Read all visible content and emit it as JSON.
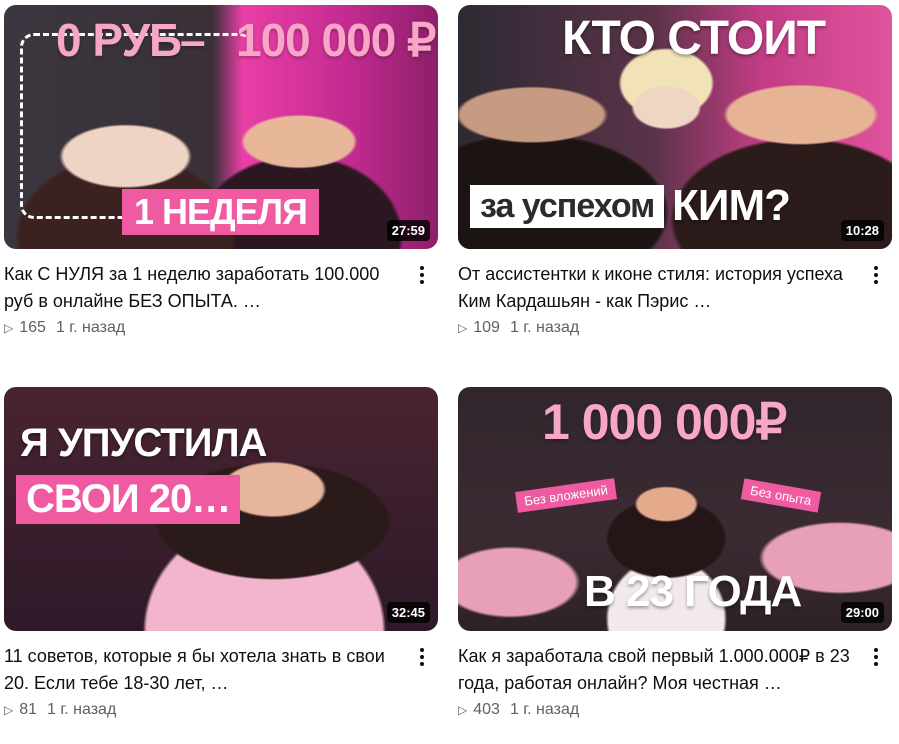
{
  "videos": [
    {
      "title": "Как С НУЛЯ за 1 неделю заработать 100.000 руб в онлайне БЕЗ ОПЫТА. …",
      "duration": "27:59",
      "views": "165",
      "age": "1 г. назад",
      "overlay": {
        "left": "0 РУБ",
        "dash": "–",
        "right": "100 000 ₽",
        "bottom": "1 НЕДЕЛЯ"
      }
    },
    {
      "title": "От ассистентки к иконе стиля: история успеха Ким Кардашьян - как Пэрис …",
      "duration": "10:28",
      "views": "109",
      "age": "1 г. назад",
      "overlay": {
        "top": "КТО СТОИТ",
        "box": "за успехом",
        "end": "КИМ?"
      }
    },
    {
      "title": "11 советов, которые я бы хотела знать в свои 20. Если тебе 18-30 лет, …",
      "duration": "32:45",
      "views": "81",
      "age": "1 г. назад",
      "overlay": {
        "line1": "Я УПУСТИЛА",
        "line2": "СВОИ 20…"
      }
    },
    {
      "title": "Как я заработала свой первый 1.000.000₽ в 23 года, работая онлайн? Моя честная …",
      "duration": "29:00",
      "views": "403",
      "age": "1 г. назад",
      "overlay": {
        "top": "1 000 000₽",
        "tag_left": "Без вложений",
        "tag_right": "Без опыта",
        "bottom": "В 23 ГОДА"
      }
    }
  ],
  "colors": {
    "accent_pink": "#f05aa0",
    "text_primary": "#0f0f0f",
    "text_secondary": "#606060"
  },
  "icons": {
    "views": "play-triangle-icon",
    "menu": "more-vert-icon"
  }
}
